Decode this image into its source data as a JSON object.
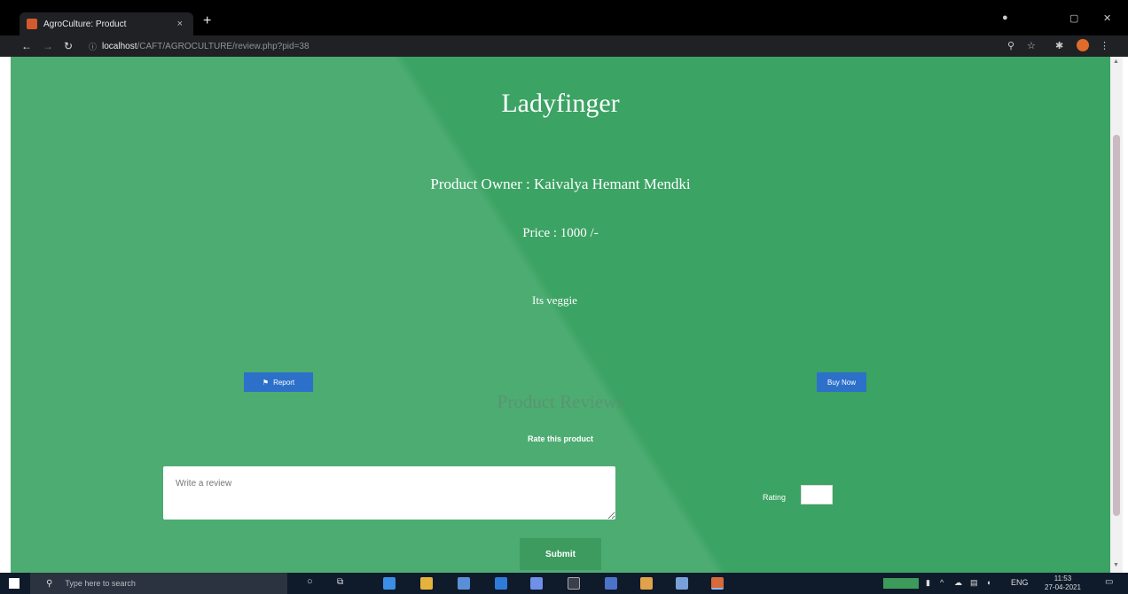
{
  "browser": {
    "tab_title": "AgroCulture: Product",
    "tab_close": "×",
    "new_tab": "+",
    "url_host": "localhost",
    "url_path": "/CAFT/AGROCULTURE/review.php?pid=38",
    "colors": {
      "chrome": "#202124",
      "tab_bar": "#000000",
      "favicon": "#d5592f"
    }
  },
  "page": {
    "title": "Ladyfinger",
    "owner": "Product Owner : Kaivalya Hemant Mendki",
    "price": "Price : 1000 /-",
    "description": "Its veggie",
    "report_button": "Report",
    "buy_button": "Buy Now",
    "reviews_heading": "Product Reviews",
    "rate_label": "Rate this product",
    "review_placeholder": "Write a review",
    "rating_label": "Rating",
    "submit_label": "Submit",
    "colors": {
      "bg_light": "#4dac72",
      "bg_dark": "#3ba363",
      "button_blue": "#2d70c9"
    }
  },
  "taskbar": {
    "search_placeholder": "Type here to search",
    "time": "11:53",
    "date": "27-04-2021",
    "lang": "ENG"
  }
}
